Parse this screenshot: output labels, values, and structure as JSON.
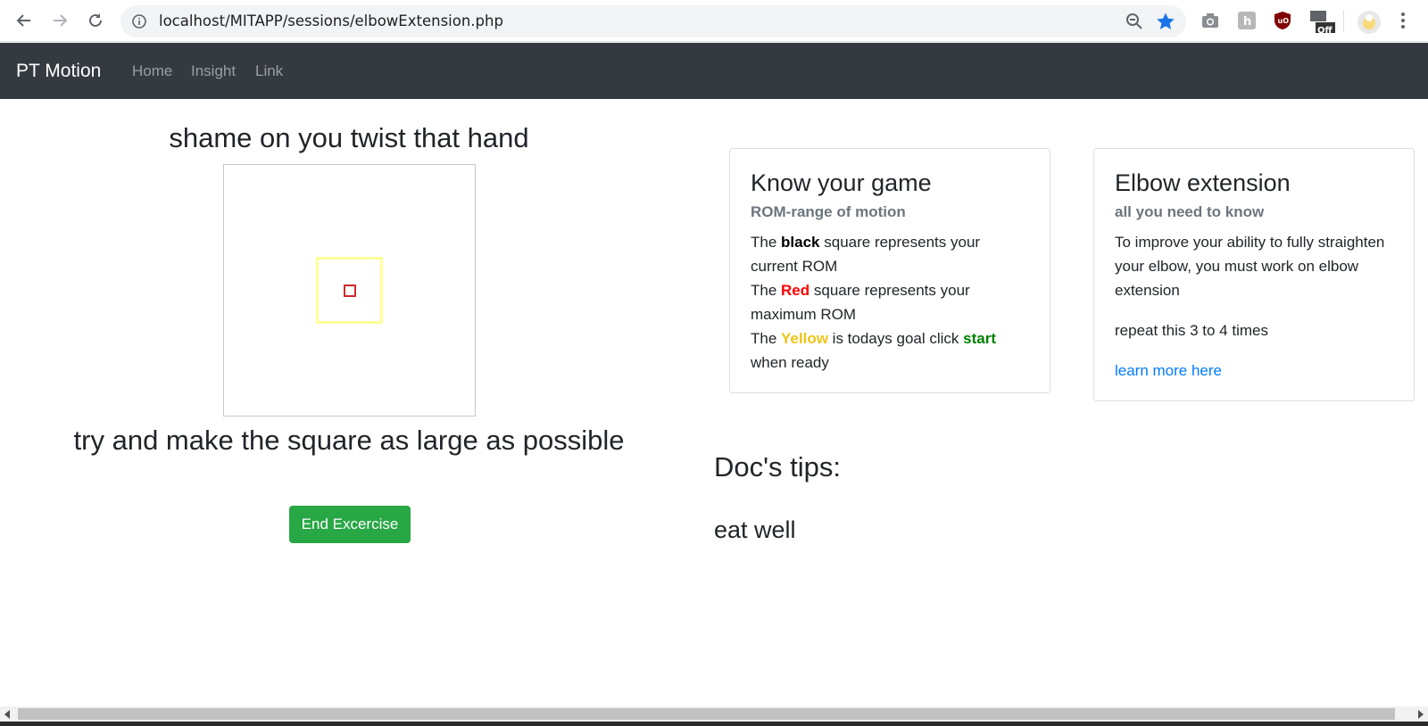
{
  "browser": {
    "url": "localhost/MITAPP/sessions/elbowExtension.php",
    "ext_off_badge": "Off"
  },
  "navbar": {
    "brand": "PT Motion",
    "links": [
      "Home",
      "Insight",
      "Link"
    ]
  },
  "exercise": {
    "heading_top": "shame on you twist that hand",
    "heading_bottom": "try and make the square as large as possible",
    "end_button": "End Excercise",
    "colors": {
      "black": "#000000",
      "red": "#cc2a2a",
      "yellow": "#ffff99"
    }
  },
  "card_game": {
    "title": "Know your game",
    "subtitle": "ROM-range of motion",
    "line1_pre": "The ",
    "line1_bold": "black",
    "line1_post": " square represents your current ROM",
    "line2_pre": "The ",
    "line2_bold": "Red",
    "line2_post": " square represents your maximum ROM",
    "line3_pre": "The ",
    "line3_bold": "Yellow",
    "line3_mid": " is todays goal click ",
    "line3_bold2": "start",
    "line3_post": " when ready"
  },
  "card_elbow": {
    "title": "Elbow extension",
    "subtitle": "all you need to know",
    "body": "To improve your ability to fully straighten your elbow, you must work on elbow extension",
    "repeat": "repeat this 3 to 4 times",
    "link": "learn more here"
  },
  "tips": {
    "title": "Doc's tips:",
    "text": "eat well"
  }
}
